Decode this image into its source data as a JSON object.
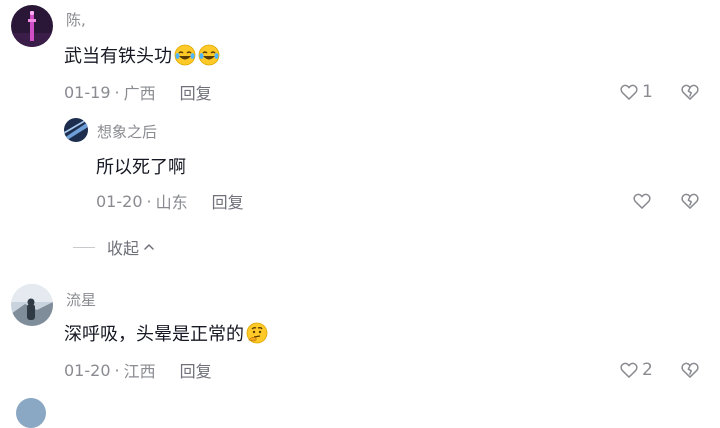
{
  "comments": [
    {
      "username": "陈,",
      "text": "武当有铁头功",
      "emojis": [
        "laughing-crying",
        "laughing-crying"
      ],
      "date": "01-19",
      "location": "广西",
      "reply_label": "回复",
      "like_count": "1",
      "replies": [
        {
          "username": "想象之后",
          "text": "所以死了啊",
          "date": "01-20",
          "location": "山东",
          "reply_label": "回复",
          "like_count": ""
        }
      ],
      "collapse_label": "收起"
    },
    {
      "username": "流星",
      "text": "深呼吸，头晕是正常的",
      "emojis": [
        "thinking-face"
      ],
      "date": "01-20",
      "location": "江西",
      "reply_label": "回复",
      "like_count": "2"
    }
  ],
  "separator": "·",
  "colors": {
    "text_primary": "#161823",
    "text_secondary": "#8a8b91",
    "background": "#ffffff"
  },
  "icons": {
    "like": "heart-outline-icon",
    "dislike": "broken-heart-icon",
    "collapse": "chevron-up-icon"
  }
}
